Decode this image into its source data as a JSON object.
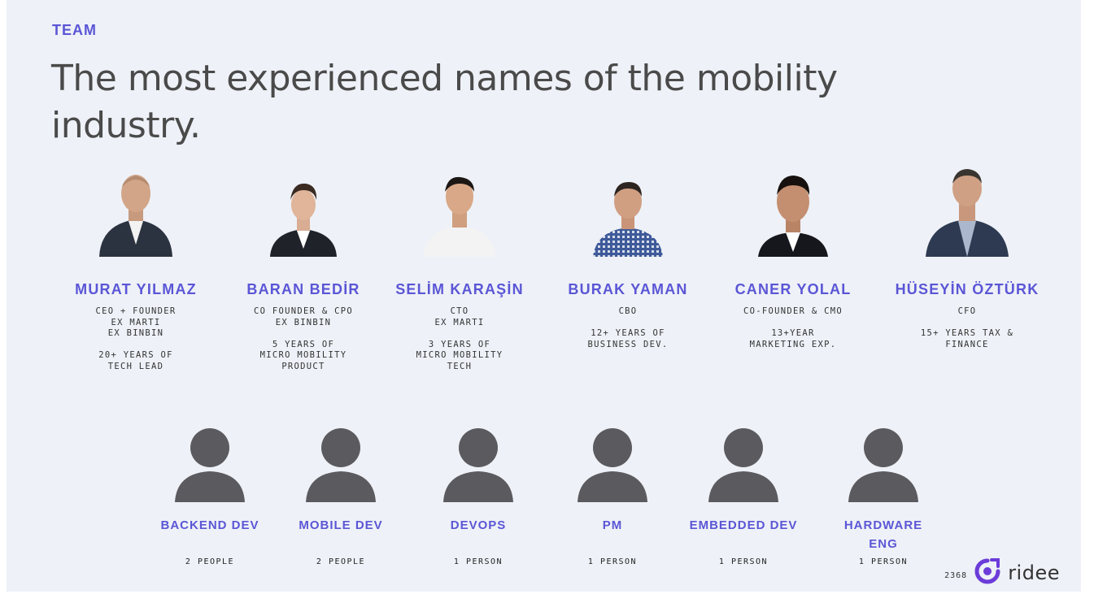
{
  "section_label": "TEAM",
  "headline": "The most experienced names of the mobility industry.",
  "colors": {
    "accent": "#5b56d6",
    "text": "#4a4a4a",
    "background": "#eef1f7",
    "person_icon": "#5b5b5f",
    "brand": "#6c3cd9"
  },
  "members": [
    {
      "name": "MURAT YILMAZ",
      "description": "CEO + FOUNDER\nEX MARTI\nEX BINBIN\n\n20+ YEARS OF\nTECH LEAD",
      "photo": "headshot-photo"
    },
    {
      "name": "BARAN BEDİR",
      "description": "CO FOUNDER & CPO\nEX BINBIN\n\n5 YEARS OF\nMICRO MOBILITY\nPRODUCT",
      "photo": "headshot-photo"
    },
    {
      "name": "SELİM KARAŞİN",
      "description": "CTO\nEX MARTI\n\n3 YEARS OF\nMICRO MOBILITY\nTECH",
      "photo": "headshot-photo"
    },
    {
      "name": "BURAK YAMAN",
      "description": "CBO\n\n12+ YEARS OF\nBUSINESS DEV.",
      "photo": "headshot-photo"
    },
    {
      "name": "CANER YOLAL",
      "description": "CO-FOUNDER & CMO\n\n13+YEAR\nMARKETING EXP.",
      "photo": "headshot-photo"
    },
    {
      "name": "HÜSEYİN ÖZTÜRK",
      "description": "CFO\n\n15+ YEARS TAX &\nFINANCE",
      "photo": "headshot-photo"
    }
  ],
  "roles": [
    {
      "title": "BACKEND DEV",
      "count": "2 PEOPLE",
      "icon": "person-icon"
    },
    {
      "title": "MOBILE DEV",
      "count": "2 PEOPLE",
      "icon": "person-icon"
    },
    {
      "title": "DEVOPS",
      "count": "1 PERSON",
      "icon": "person-icon"
    },
    {
      "title": "PM",
      "count": "1 PERSON",
      "icon": "person-icon"
    },
    {
      "title": "EMBEDDED DEV",
      "count": "1 PERSON",
      "icon": "person-icon"
    },
    {
      "title": "HARDWARE\nENG",
      "count": "1 PERSON",
      "icon": "person-icon"
    }
  ],
  "footer": {
    "page_number": "2368",
    "brand_name": "ridee",
    "logo": "ridee-logo-icon"
  }
}
